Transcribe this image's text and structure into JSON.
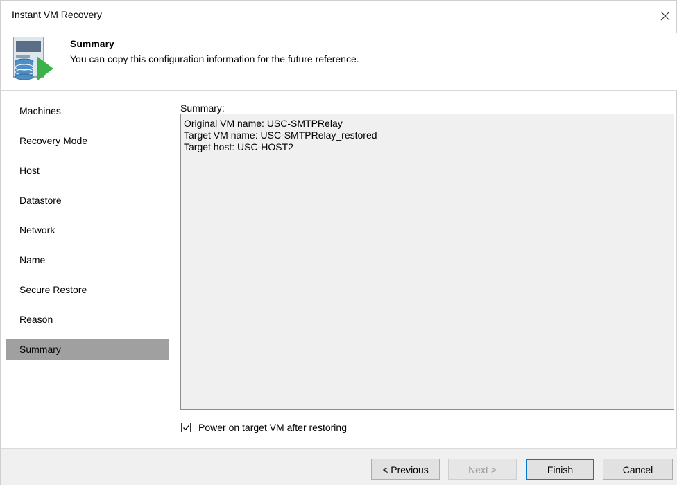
{
  "window": {
    "title": "Instant VM Recovery",
    "close_icon": "close-icon"
  },
  "header": {
    "title": "Summary",
    "subtitle": "You can copy this configuration information for the future reference.",
    "icon": "vm-restore-icon"
  },
  "sidebar": {
    "items": [
      {
        "label": "Machines",
        "active": false
      },
      {
        "label": "Recovery Mode",
        "active": false
      },
      {
        "label": "Host",
        "active": false
      },
      {
        "label": "Datastore",
        "active": false
      },
      {
        "label": "Network",
        "active": false
      },
      {
        "label": "Name",
        "active": false
      },
      {
        "label": "Secure Restore",
        "active": false
      },
      {
        "label": "Reason",
        "active": false
      },
      {
        "label": "Summary",
        "active": true
      }
    ]
  },
  "summary": {
    "label": "Summary:",
    "text": "Original VM name: USC-SMTPRelay\nTarget VM name: USC-SMTPRelay_restored\nTarget host: USC-HOST2"
  },
  "options": {
    "power_on_label": "Power on target VM after restoring",
    "power_on_checked": true
  },
  "buttons": {
    "previous": "< Previous",
    "next": "Next >",
    "finish": "Finish",
    "cancel": "Cancel"
  },
  "colors": {
    "selected_nav": "#a0a0a0",
    "accent_green": "#3cb34a",
    "default_button_border": "#0078d7"
  }
}
